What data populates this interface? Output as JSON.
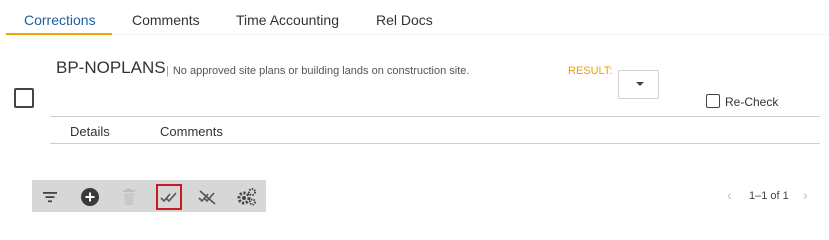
{
  "tabs": [
    {
      "label": "Corrections",
      "active": true
    },
    {
      "label": "Comments",
      "active": false
    },
    {
      "label": "Time Accounting",
      "active": false
    },
    {
      "label": "Rel Docs",
      "active": false
    }
  ],
  "correction": {
    "code": "BP-NOPLANS",
    "separator": "|",
    "description": "No approved site plans or building lands on construction site.",
    "result_label": "RESULT:",
    "result_value": "",
    "recheck_label": "Re-Check"
  },
  "subtabs": [
    {
      "label": "Details"
    },
    {
      "label": "Comments"
    }
  ],
  "toolbar": {
    "buttons": [
      {
        "name": "filter-icon"
      },
      {
        "name": "add-icon"
      },
      {
        "name": "delete-icon",
        "disabled": true
      },
      {
        "name": "check-all-icon",
        "selected": true
      },
      {
        "name": "uncheck-all-icon"
      },
      {
        "name": "settings-icon"
      }
    ]
  },
  "pager": {
    "prev": "‹",
    "text": "1–1 of 1",
    "next": "›"
  },
  "colors": {
    "accent": "#f0a500",
    "active_tab": "#1f5f9f",
    "result_label": "#e5a100",
    "selected_border": "#c61d24",
    "toolbar_bg": "#d7d7d7"
  }
}
